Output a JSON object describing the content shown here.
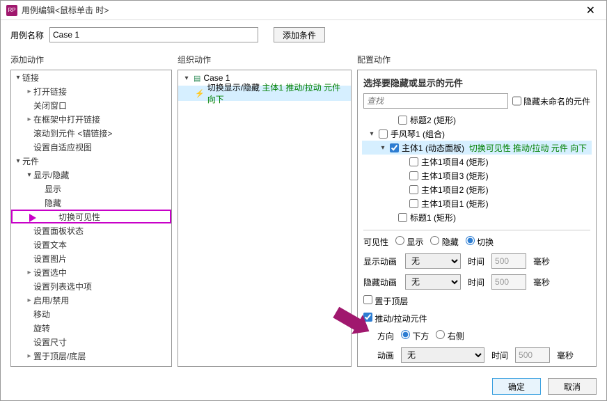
{
  "window": {
    "title": "用例编辑<鼠标单击 时>"
  },
  "top": {
    "name_label": "用例名称",
    "name_value": "Case 1",
    "add_condition": "添加条件"
  },
  "columns": {
    "add_action": "添加动作",
    "org_action": "组织动作",
    "config_action": "配置动作"
  },
  "actions_tree": {
    "link": "链接",
    "open_link": "打开链接",
    "close_window": "关闭窗口",
    "open_in_frame": "在框架中打开链接",
    "scroll_to_anchor": "滚动到元件 <锚链接>",
    "adaptive_view": "设置自适应视图",
    "widget": "元件",
    "show_hide": "显示/隐藏",
    "show": "显示",
    "hide": "隐藏",
    "toggle_vis": "切换可见性",
    "panel_state": "设置面板状态",
    "set_text": "设置文本",
    "set_image": "设置图片",
    "set_selected": "设置选中",
    "set_list_selected": "设置列表选中项",
    "enable_disable": "启用/禁用",
    "move": "移动",
    "rotate": "旋转",
    "set_size": "设置尺寸",
    "bring_front": "置于顶层/底层"
  },
  "case": {
    "name": "Case 1",
    "action": {
      "verb": "切换显示/隐藏",
      "rest": "主体1 推动/拉动 元件 向下"
    }
  },
  "config": {
    "select_widgets": "选择要隐藏或显示的元件",
    "search_placeholder": "查找",
    "hide_unnamed": "隐藏未命名的元件",
    "tree": {
      "title2": "标题2 (矩形)",
      "accordion": "手风琴1 (组合)",
      "body_dp": "主体1 (动态面板)",
      "body_dp_suffix": "切换可见性 推动/拉动 元件 向下",
      "item4": "主体1项目4 (矩形)",
      "item3": "主体1项目3 (矩形)",
      "item2": "主体1项目2 (矩形)",
      "item1": "主体1项目1 (矩形)",
      "title1": "标题1 (矩形)"
    },
    "visibility_label": "可见性",
    "vis_show": "显示",
    "vis_hide": "隐藏",
    "vis_toggle": "切换",
    "show_anim_label": "显示动画",
    "hide_anim_label": "隐藏动画",
    "anim_none": "无",
    "time_label": "时间",
    "time_value": "500",
    "ms": "毫秒",
    "bring_top": "置于顶层",
    "push_pull": "推动/拉动元件",
    "dir_label": "方向",
    "dir_down": "下方",
    "dir_right": "右侧",
    "anim_label": "动画"
  },
  "footer": {
    "ok": "确定",
    "cancel": "取消"
  }
}
